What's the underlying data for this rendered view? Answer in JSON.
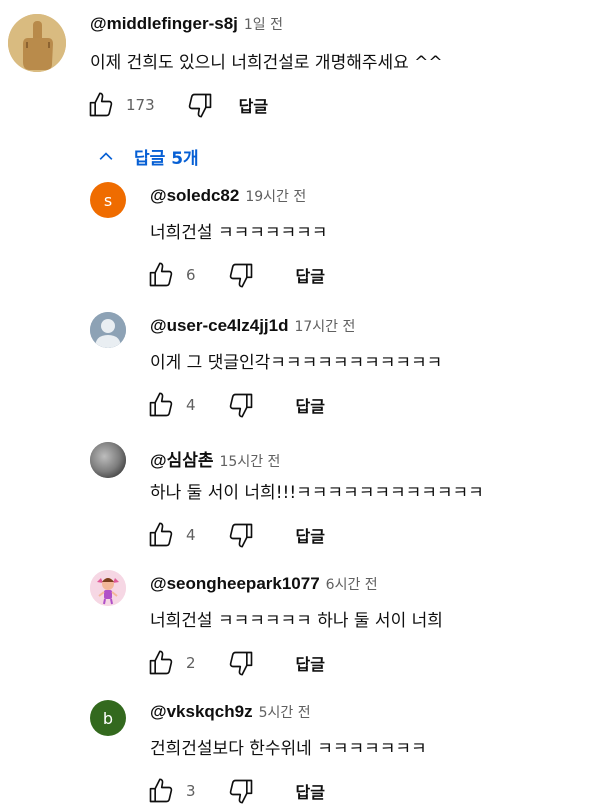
{
  "top_comment": {
    "author": "@middlefinger-s8j",
    "time": "1일 전",
    "text": "이제 건희도 있으니 너희건설로 개명해주세요 ^^",
    "likes": "173",
    "reply_label": "답글",
    "avatar_icon": "middle-finger-avatar"
  },
  "replies_toggle": {
    "label": "답글 5개",
    "icon": "chevron-up-icon"
  },
  "replies": [
    {
      "author": "@soledc82",
      "time": "19시간 전",
      "text": "너희건설 ㅋㅋㅋㅋㅋㅋㅋ",
      "likes": "6",
      "reply_label": "답글",
      "avatar_letter": "s",
      "avatar_color": "#ef6c00"
    },
    {
      "author": "@user-ce4lz4jj1d",
      "time": "17시간 전",
      "text": "이게 그 댓글인각ㅋㅋㅋㅋㅋㅋㅋㅋㅋㅋㅋ",
      "likes": "4",
      "reply_label": "답글",
      "avatar_icon": "default-user-avatar",
      "avatar_color": "#8da2b5"
    },
    {
      "author": "@심삼촌",
      "time": "15시간 전",
      "text": "하나 둘 서이 너희!!!ㅋㅋㅋㅋㅋㅋㅋㅋㅋㅋㅋㅋ",
      "likes": "4",
      "reply_label": "답글",
      "avatar_icon": "photo-avatar",
      "avatar_color": "#7a7a7a"
    },
    {
      "author": "@seongheepark1077",
      "time": "6시간 전",
      "text": "너희건설 ㅋㅋㅋㅋㅋㅋ 하나 둘 서이 너희",
      "likes": "2",
      "reply_label": "답글",
      "avatar_icon": "cartoon-avatar",
      "avatar_color": "#f6d7e4"
    },
    {
      "author": "@vkskqch9z",
      "time": "5시간 전",
      "text": "건희건설보다 한수위네 ㅋㅋㅋㅋㅋㅋㅋ",
      "likes": "3",
      "reply_label": "답글",
      "avatar_letter": "b",
      "avatar_color": "#33691e"
    }
  ]
}
